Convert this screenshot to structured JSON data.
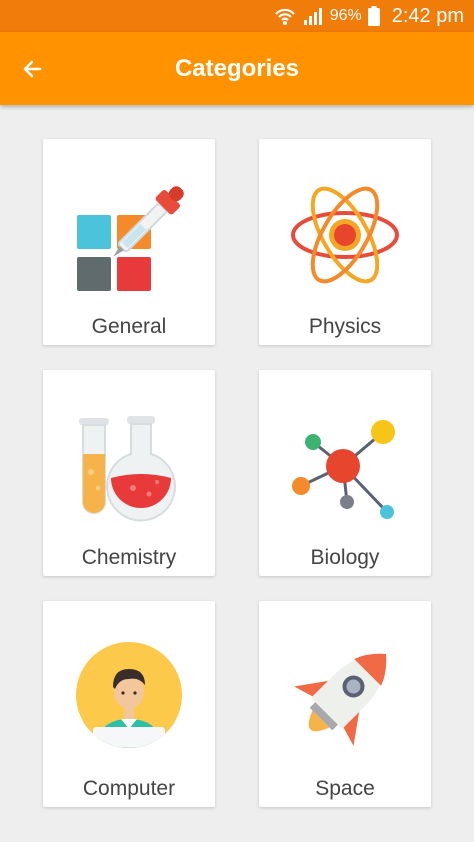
{
  "status_bar": {
    "battery_percent": "96%",
    "time": "2:42 pm",
    "icons": [
      "wifi-icon",
      "signal-icon",
      "battery-icon"
    ]
  },
  "app_bar": {
    "title": "Categories",
    "back_icon": "arrow-left-icon"
  },
  "categories": [
    {
      "label": "General",
      "icon": "dropper-palette-icon"
    },
    {
      "label": "Physics",
      "icon": "atom-icon"
    },
    {
      "label": "Chemistry",
      "icon": "flask-icon"
    },
    {
      "label": "Biology",
      "icon": "molecule-icon"
    },
    {
      "label": "Computer",
      "icon": "person-laptop-icon"
    },
    {
      "label": "Space",
      "icon": "rocket-icon"
    }
  ],
  "colors": {
    "status_bar": "#f07c0a",
    "app_bar": "#ff9200",
    "background": "#eeeeee",
    "card": "#ffffff"
  }
}
